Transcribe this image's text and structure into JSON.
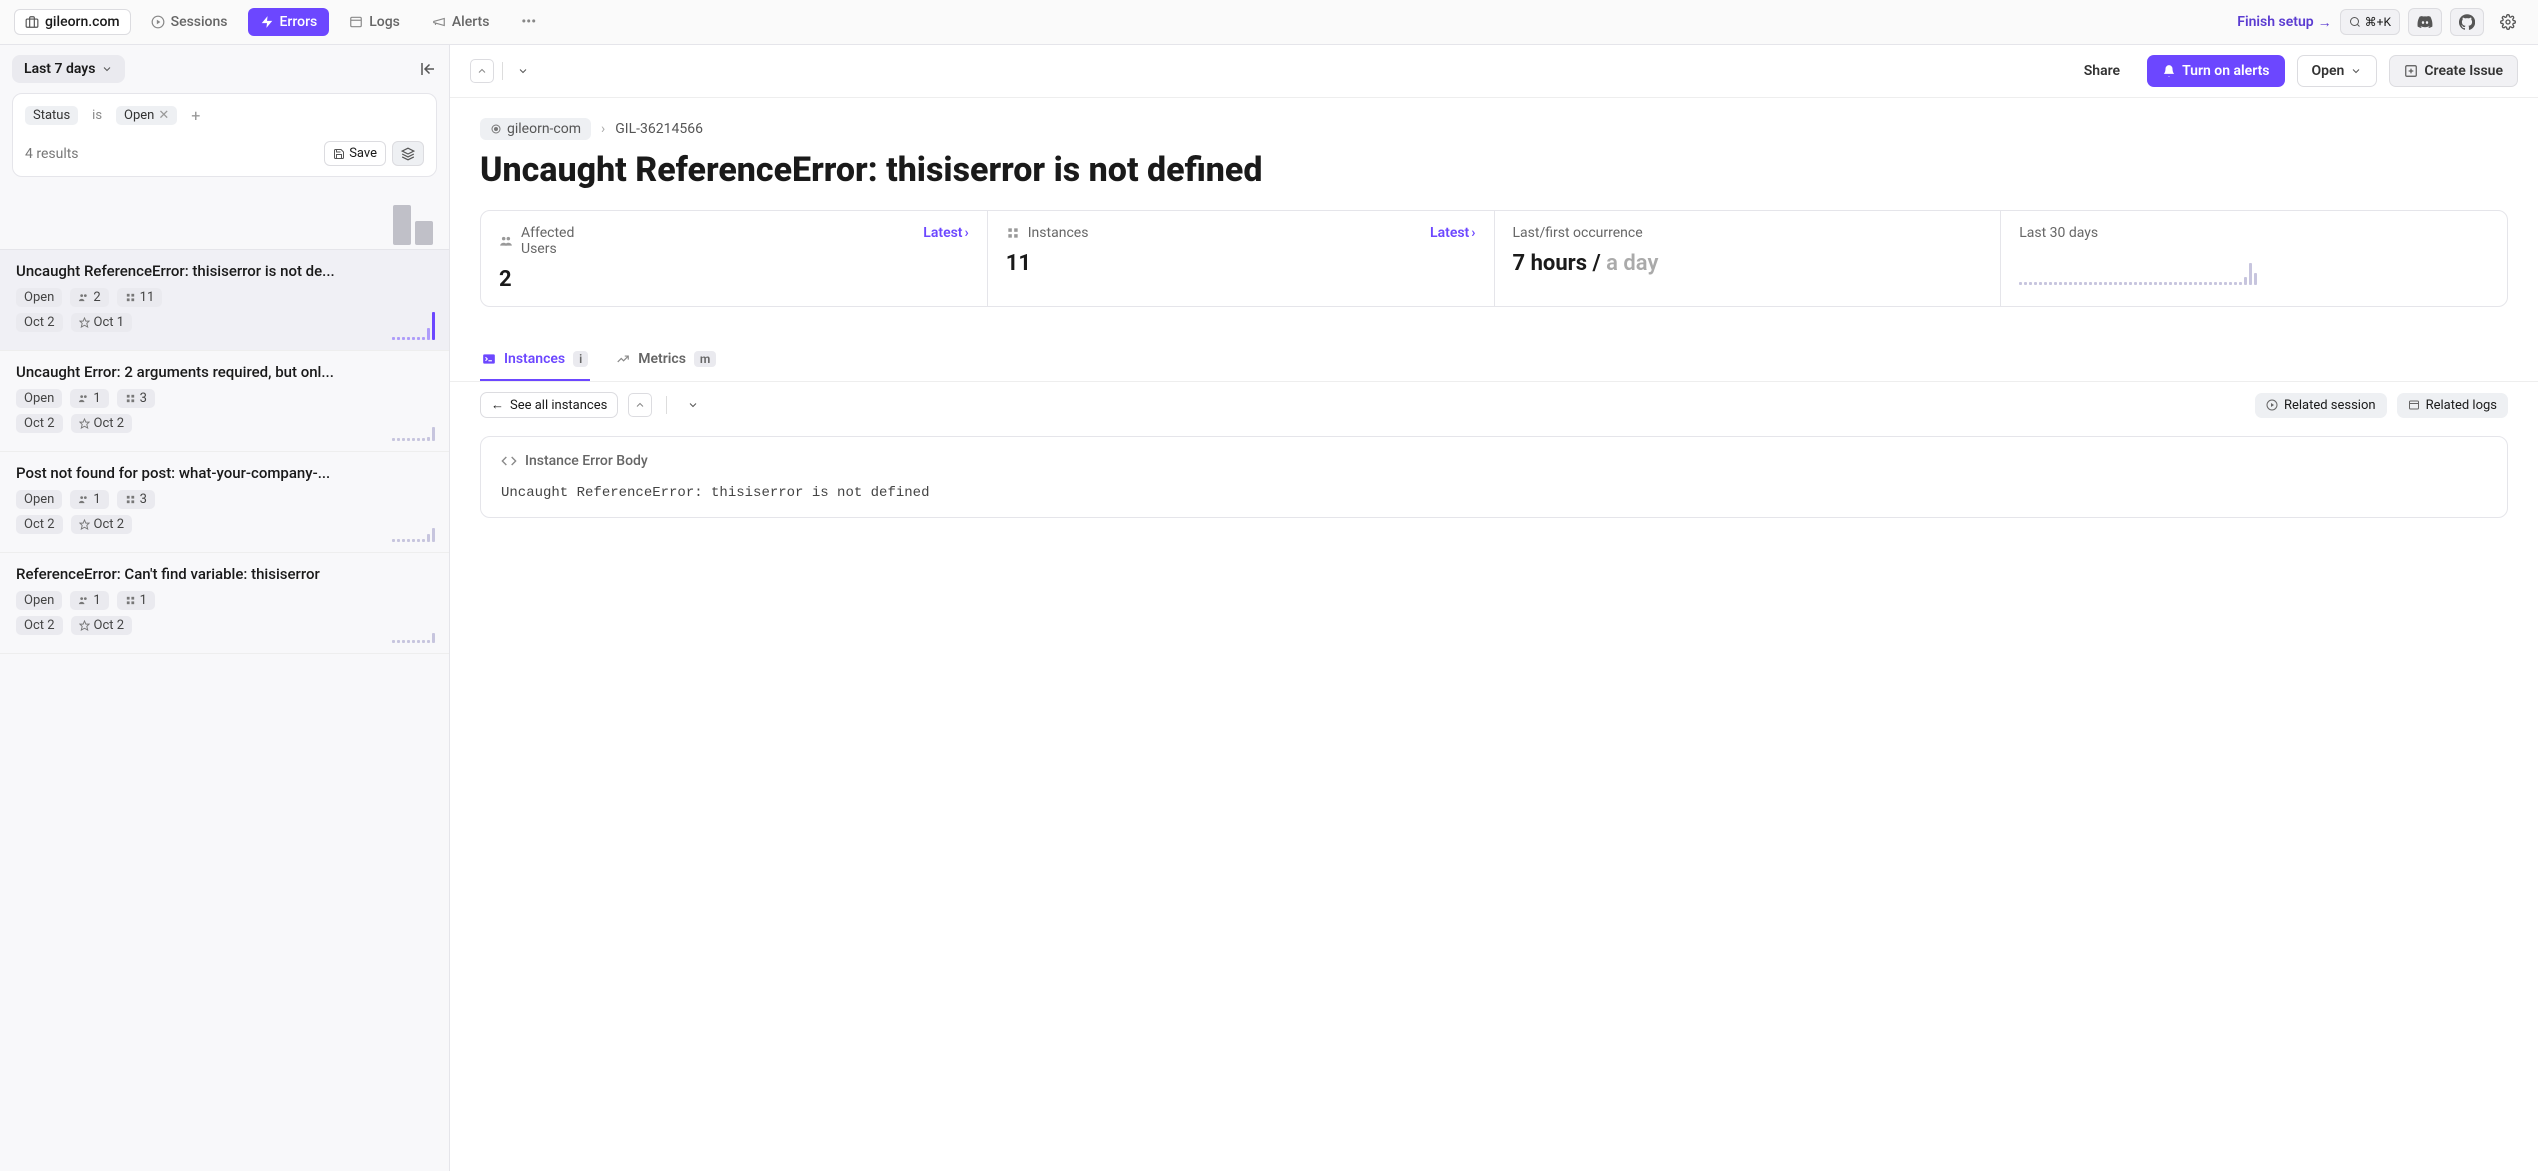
{
  "topbar": {
    "project": "gileorn.com",
    "nav": {
      "sessions": "Sessions",
      "errors": "Errors",
      "logs": "Logs",
      "alerts": "Alerts"
    },
    "finish_setup": "Finish setup",
    "cmdk": "⌘+K"
  },
  "sidebar": {
    "time_range": "Last 7 days",
    "filter": {
      "key": "Status",
      "op": "is",
      "val": "Open"
    },
    "results_text": "4 results",
    "save_label": "Save",
    "mini_bars": [
      40,
      24
    ],
    "errors": [
      {
        "title": "Uncaught ReferenceError: thisiserror is not de...",
        "status": "Open",
        "users": "2",
        "instances": "11",
        "date": "Oct 2",
        "first": "Oct 1",
        "selected": true,
        "spark": [
          3,
          3,
          3,
          3,
          3,
          3,
          3,
          12,
          28
        ],
        "color": "purple"
      },
      {
        "title": "Uncaught Error: 2 arguments required, but onl...",
        "status": "Open",
        "users": "1",
        "instances": "3",
        "date": "Oct 2",
        "first": "Oct 2",
        "selected": false,
        "spark": [
          3,
          3,
          3,
          3,
          3,
          3,
          3,
          4,
          14
        ],
        "color": "grey"
      },
      {
        "title": "Post not found for post: what-your-company-...",
        "status": "Open",
        "users": "1",
        "instances": "3",
        "date": "Oct 2",
        "first": "Oct 2",
        "selected": false,
        "spark": [
          3,
          3,
          3,
          3,
          3,
          3,
          3,
          8,
          14
        ],
        "color": "grey"
      },
      {
        "title": "ReferenceError: Can't find variable: thisiserror",
        "status": "Open",
        "users": "1",
        "instances": "1",
        "date": "Oct 2",
        "first": "Oct 2",
        "selected": false,
        "spark": [
          3,
          3,
          3,
          3,
          3,
          3,
          3,
          3,
          10
        ],
        "color": "grey"
      }
    ]
  },
  "main": {
    "share": "Share",
    "turn_on_alerts": "Turn on alerts",
    "open_label": "Open",
    "create_issue": "Create Issue",
    "breadcrumb": {
      "project": "gileorn-com",
      "id": "GIL-36214566"
    },
    "title": "Uncaught ReferenceError: thisiserror is not defined",
    "stats": {
      "affected_users": {
        "label": "Affected Users",
        "latest": "Latest",
        "value": "2"
      },
      "instances": {
        "label": "Instances",
        "latest": "Latest",
        "value": "11"
      },
      "occurrence": {
        "label": "Last/first occurrence",
        "last": "7 hours",
        "first": "a day"
      },
      "last30": {
        "label": "Last 30 days"
      }
    },
    "tabs": {
      "instances": "Instances",
      "instances_key": "i",
      "metrics": "Metrics",
      "metrics_key": "m"
    },
    "see_all": "See all instances",
    "related_session": "Related session",
    "related_logs": "Related logs",
    "body_label": "Instance Error Body",
    "body_code": "Uncaught ReferenceError: thisiserror is not defined"
  }
}
